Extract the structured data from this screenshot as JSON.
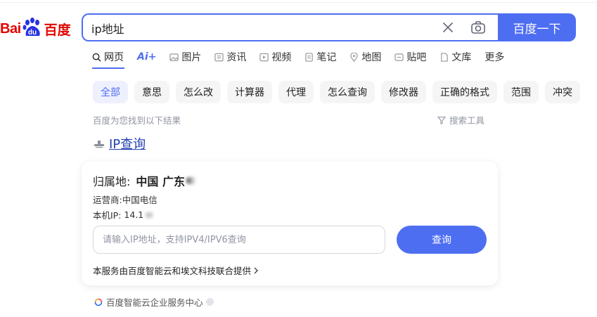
{
  "logo": {
    "left_text": "Bai",
    "paw_text": "du",
    "cn_text": "百度"
  },
  "search": {
    "value": "ip地址",
    "placeholder": "",
    "button_label": "百度一下"
  },
  "tabs": [
    {
      "label": "网页",
      "icon": "search-icon",
      "active": true
    },
    {
      "label": "Ai+",
      "icon": "ai-icon"
    },
    {
      "label": "图片",
      "icon": "image-icon"
    },
    {
      "label": "资讯",
      "icon": "news-icon"
    },
    {
      "label": "视频",
      "icon": "video-icon"
    },
    {
      "label": "笔记",
      "icon": "note-icon"
    },
    {
      "label": "地图",
      "icon": "map-icon"
    },
    {
      "label": "贴吧",
      "icon": "tieba-icon"
    },
    {
      "label": "文库",
      "icon": "doc-icon"
    },
    {
      "label": "更多",
      "icon": ""
    }
  ],
  "chips": [
    "全部",
    "意思",
    "怎么改",
    "计算器",
    "代理",
    "怎么查询",
    "修改器",
    "正确的格式",
    "范围",
    "冲突"
  ],
  "results_found": "百度为您找到以下结果",
  "search_tools": "搜索工具",
  "result": {
    "title": "IP查询",
    "location_label": "归属地:",
    "location_value": "中国 广东",
    "isp_label": "运营商:",
    "isp_value": "中国电信",
    "local_ip_label": "本机IP:",
    "local_ip_value": "14.1",
    "input_placeholder": "请输入IP地址，支持IPV4/IPV6查询",
    "query_button": "查询",
    "provider": "本服务由百度智能云和埃文科技联合提供"
  },
  "source": {
    "label": "百度智能云企业服务中心"
  },
  "colors": {
    "brand_blue": "#4e6ef2",
    "baidu_red": "#e10601",
    "link_blue": "#2440b3"
  }
}
